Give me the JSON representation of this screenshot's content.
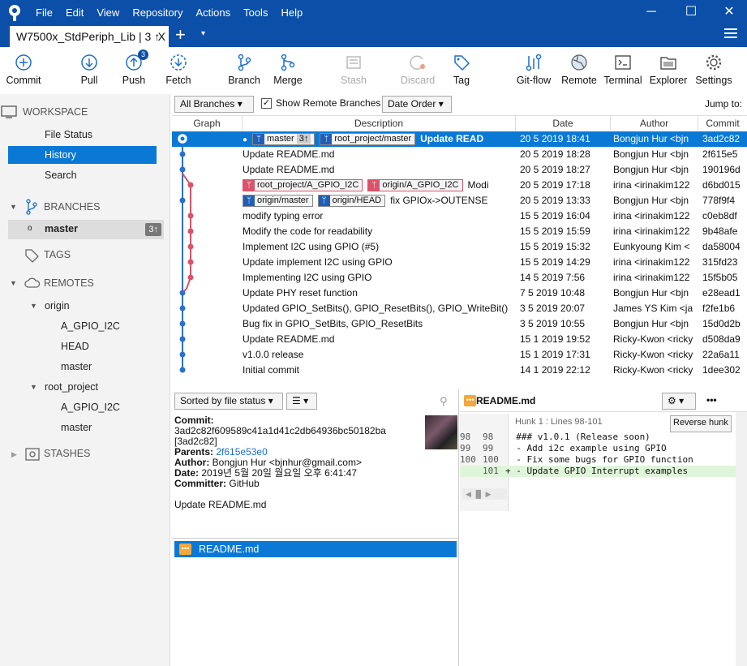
{
  "window": {
    "tab_title": "W7500x_StdPeriph_Lib | 3 ↑",
    "tab_close": "X",
    "new_tab": "+",
    "dropdown": "▾"
  },
  "menu": [
    "File",
    "Edit",
    "View",
    "Repository",
    "Actions",
    "Tools",
    "Help"
  ],
  "window_controls": {
    "minimize": "─",
    "maximize": "☐",
    "close": "✕"
  },
  "toolbar": [
    {
      "label": "Commit",
      "icon": "plus-circle-icon"
    },
    {
      "label": "Pull",
      "icon": "arrow-down-circle-icon"
    },
    {
      "label": "Push",
      "icon": "arrow-up-circle-icon",
      "badge": "3"
    },
    {
      "label": "Fetch",
      "icon": "fetch-icon"
    },
    {
      "label": "Branch",
      "icon": "branch-icon"
    },
    {
      "label": "Merge",
      "icon": "merge-icon"
    },
    {
      "label": "Stash",
      "icon": "stash-icon",
      "disabled": true
    },
    {
      "label": "Discard",
      "icon": "discard-icon",
      "disabled": true
    },
    {
      "label": "Tag",
      "icon": "tag-icon"
    },
    {
      "label": "Git-flow",
      "icon": "gitflow-icon"
    },
    {
      "label": "Remote",
      "icon": "globe-icon"
    },
    {
      "label": "Terminal",
      "icon": "terminal-icon"
    },
    {
      "label": "Explorer",
      "icon": "folder-icon"
    },
    {
      "label": "Settings",
      "icon": "gear-icon"
    }
  ],
  "sidebar": {
    "workspace": "WORKSPACE",
    "workspace_items": [
      "File Status",
      "History",
      "Search"
    ],
    "branches": "BRANCHES",
    "current_branch": "master",
    "current_branch_badge": "3↑",
    "tags": "TAGS",
    "remotes": "REMOTES",
    "origin": "origin",
    "origin_items": [
      "A_GPIO_I2C",
      "HEAD",
      "master"
    ],
    "root_project": "root_project",
    "root_items": [
      "A_GPIO_I2C",
      "master"
    ],
    "stashes": "STASHES"
  },
  "filters": {
    "branches": "All Branches ▾",
    "show_remote": "Show Remote Branches",
    "order": "Date Order ▾",
    "jump": "Jump to:"
  },
  "columns": {
    "graph": "Graph",
    "description": "Description",
    "date": "Date",
    "author": "Author",
    "commit": "Commit"
  },
  "commits": [
    {
      "desc": "Update READ",
      "date": "20 5 2019 18:41",
      "author": "Bongjun Hur <bjn",
      "hash": "3ad2c82",
      "refs": [
        {
          "name": "master",
          "extra": "3↑",
          "color": "blue"
        },
        {
          "name": "root_project/master",
          "color": "blue"
        }
      ]
    },
    {
      "desc": "Update README.md",
      "date": "20 5 2019 18:28",
      "author": "Bongjun Hur <bjn",
      "hash": "2f615e5"
    },
    {
      "desc": "Update README.md",
      "date": "20 5 2019 18:27",
      "author": "Bongjun Hur <bjn",
      "hash": "190196d"
    },
    {
      "desc": "Modi",
      "date": "20 5 2019 17:18",
      "author": "irina <irinakim122",
      "hash": "d6bd015",
      "refs": [
        {
          "name": "root_project/A_GPIO_I2C",
          "color": "red"
        },
        {
          "name": "origin/A_GPIO_I2C",
          "color": "red"
        }
      ]
    },
    {
      "desc": "fix GPIOx->OUTENSE",
      "date": "20 5 2019 13:33",
      "author": "Bongjun Hur <bjn",
      "hash": "778f9f4",
      "refs": [
        {
          "name": "origin/master",
          "color": "blue"
        },
        {
          "name": "origin/HEAD",
          "color": "blue"
        }
      ]
    },
    {
      "desc": "modify  typing error",
      "date": "15 5 2019 16:04",
      "author": "irina <irinakim122",
      "hash": "c0eb8df"
    },
    {
      "desc": "Modify the code for readability",
      "date": "15 5 2019 15:59",
      "author": "irina <irinakim122",
      "hash": "9b48afe"
    },
    {
      "desc": "Implement I2C using GPIO (#5)",
      "date": "15 5 2019 15:32",
      "author": "Eunkyoung Kim <",
      "hash": "da58004"
    },
    {
      "desc": "Update implement I2C using GPIO",
      "date": "15 5 2019 14:29",
      "author": "irina <irinakim122",
      "hash": "315fd23"
    },
    {
      "desc": "Implementing I2C using GPIO",
      "date": "14 5 2019 7:56",
      "author": "irina <irinakim122",
      "hash": "15f5b05"
    },
    {
      "desc": "Update PHY reset function",
      "date": "7 5 2019 10:48",
      "author": "Bongjun Hur <bjn",
      "hash": "e28ead1"
    },
    {
      "desc": "Updated GPIO_SetBits(), GPIO_ResetBits(), GPIO_WriteBit() in w",
      "date": "3 5 2019 20:07",
      "author": "James YS Kim <jav",
      "hash": "f2fe1b6"
    },
    {
      "desc": "Bug fix in GPIO_SetBits, GPIO_ResetBits",
      "date": "3 5 2019 10:55",
      "author": "Bongjun Hur <bjn",
      "hash": "15d0d2b"
    },
    {
      "desc": "Update README.md",
      "date": "15 1 2019 19:52",
      "author": "Ricky-Kwon <ricky",
      "hash": "d508da9"
    },
    {
      "desc": "v1.0.0 release",
      "date": "15 1 2019 17:31",
      "author": "Ricky-Kwon <ricky",
      "hash": "22a6a11"
    },
    {
      "desc": "Initial commit",
      "date": "14 1 2019 22:12",
      "author": "Ricky-Kwon <ricky",
      "hash": "1dee302"
    }
  ],
  "details": {
    "sort": "Sorted by file status ▾",
    "commit_label": "Commit:",
    "commit_full": "3ad2c82f609589c41a1d41c2db64936bc50182ba",
    "commit_short": "[3ad2c82]",
    "parents_label": "Parents:",
    "parents": "2f615e53e0",
    "author_label": "Author:",
    "author": "Bongjun Hur <bjnhur@gmail.com>",
    "date_label": "Date:",
    "date": "2019년 5월 20일 월요일 오후 6:41:47",
    "committer_label": "Committer:",
    "committer": "GitHub",
    "message": "Update README.md",
    "file": "README.md"
  },
  "diff": {
    "file": "README.md",
    "hunk": "Hunk 1 : Lines 98-101",
    "reverse": "Reverse hunk",
    "more": "•••",
    "lines": [
      {
        "old": "98",
        "new": "98",
        "text": "  ### v1.0.1 (Release soon)"
      },
      {
        "old": "99",
        "new": "99",
        "text": "  - Add i2c example using GPIO"
      },
      {
        "old": "100",
        "new": "100",
        "text": "  - Fix some bugs for GPIO function"
      },
      {
        "old": "",
        "new": "101",
        "text": "+ - Update GPIO Interrupt examples",
        "added": true
      }
    ]
  }
}
